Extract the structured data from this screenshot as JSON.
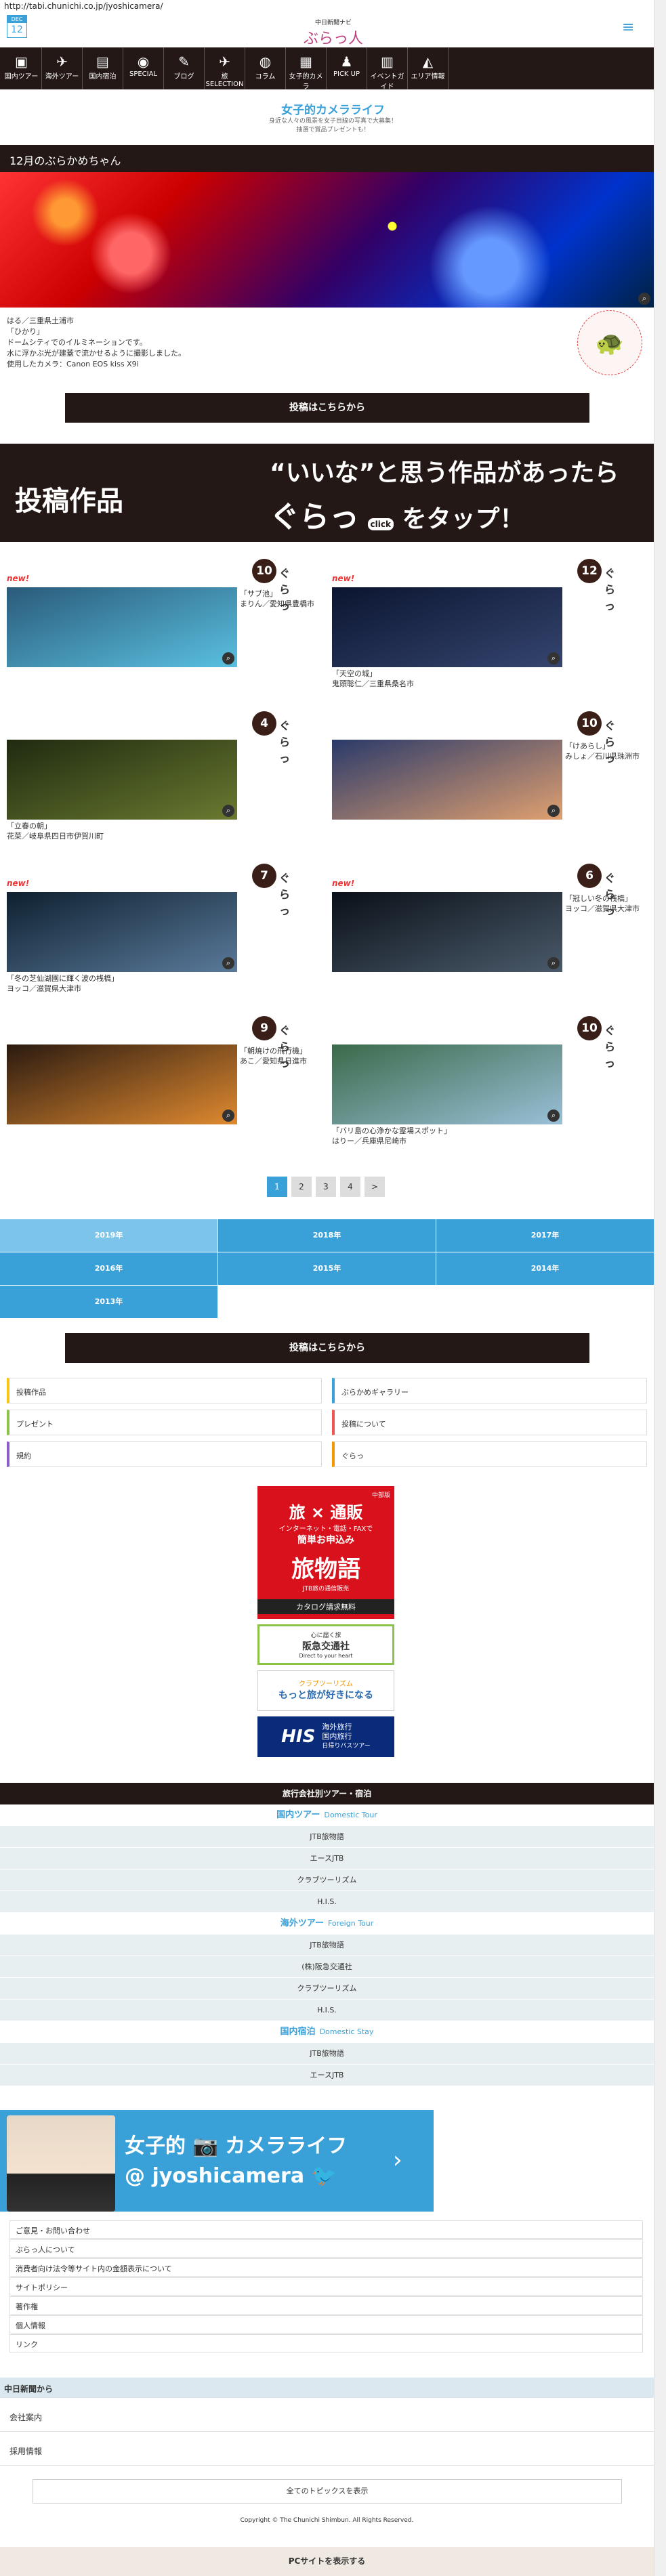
{
  "url": "http://tabi.chunichi.co.jp/jyoshicamera/",
  "date": {
    "month": "DEC",
    "day": "12"
  },
  "logo": {
    "small": "中日新聞ナビ",
    "big": "ぶらっ人"
  },
  "menu_icon": "hamburger-icon",
  "nav": [
    {
      "label": "国内ツアー",
      "icon": "▣"
    },
    {
      "label": "海外ツアー",
      "icon": "✈"
    },
    {
      "label": "国内宿泊",
      "icon": "▤"
    },
    {
      "label": "SPECIAL",
      "icon": "◉"
    },
    {
      "label": "ブログ",
      "icon": "✎"
    },
    {
      "label": "旅SELECTION",
      "icon": "✈"
    },
    {
      "label": "コラム",
      "icon": "◍"
    },
    {
      "label": "女子的カメラ",
      "icon": "▦"
    },
    {
      "label": "PICK UP",
      "icon": "♟"
    },
    {
      "label": "イベントガイド",
      "icon": "▥"
    },
    {
      "label": "エリア情報",
      "icon": "◭"
    }
  ],
  "tagline": {
    "title": "女子的カメラライフ",
    "sub1": "身近な人々の風景を女子目線の写真で大募集！",
    "sub2": "抽選で賞品プレゼントも！"
  },
  "month_title": "12月のぶらかめちゃん",
  "desc": [
    "はる／三重県土浦市",
    "「ひかり」",
    "ドームシティでのイルミネーションです。",
    "水に浮かぶ光が建蓋で流かせるように撮影しました。",
    "使用したカメラ：Canon EOS kiss X9i"
  ],
  "post_button": "投稿はこちらから",
  "banner": {
    "left": "投稿作品",
    "right1": "“いいな”と思う作品があったら",
    "right2_a": "ぐらっ",
    "right2_b": "をタップ！"
  },
  "new_label": "new!",
  "gura_label": "ぐらっ",
  "cards": [
    {
      "count": "10",
      "title": "「サブ池」",
      "author": "まりん／愛知県豊橋市",
      "colors": [
        "#2a5a7a",
        "#5ac0e0"
      ]
    },
    {
      "count": "12",
      "title": "「天空の城」",
      "author": "鬼頭聡仁／三重県桑名市",
      "colors": [
        "#0b1530",
        "#35456f"
      ]
    },
    {
      "count": "4",
      "title": "「立春の朝」",
      "author": "花菜／岐阜県四日市伊賀川町",
      "colors": [
        "#1f2a10",
        "#6a7a30"
      ]
    },
    {
      "count": "10",
      "title": "「けあらし」",
      "author": "みしょ／石川県珠洲市",
      "colors": [
        "#2a3a6a",
        "#e0a070"
      ]
    },
    {
      "count": "7",
      "title": "「冬の芝仙湖園に輝く波の桟橋」",
      "author": "ヨッコ／滋賀県大津市",
      "colors": [
        "#0e2030",
        "#5a7a9a"
      ]
    },
    {
      "count": "6",
      "title": "「冠しい冬の桟橋」",
      "author": "ヨッコ／滋賀県大津市",
      "colors": [
        "#0a1018",
        "#4a5a6a"
      ]
    },
    {
      "count": "9",
      "title": "「朝焼けの飛行機」",
      "author": "あこ／愛知県日進市",
      "colors": [
        "#2a1a10",
        "#e08a30"
      ]
    },
    {
      "count": "10",
      "title": "「バリ島の心浄かな霊場スポット」",
      "author": "はりー／兵庫県尼崎市",
      "colors": [
        "#3a6a4a",
        "#9ac0d8"
      ]
    }
  ],
  "pager": [
    "1",
    "2",
    "3",
    "4",
    ">"
  ],
  "years": [
    "2019年",
    "2018年",
    "2017年",
    "2016年",
    "2015年",
    "2014年",
    "2013年"
  ],
  "links": [
    {
      "label": "投稿作品",
      "color": "#f5c518"
    },
    {
      "label": "ぶらかめギャラリー",
      "color": "#3aa0d8"
    },
    {
      "label": "プレゼント",
      "color": "#8bc34a"
    },
    {
      "label": "投稿について",
      "color": "#e55"
    },
    {
      "label": "規約",
      "color": "#8a5cc8"
    },
    {
      "label": "ぐらっ",
      "color": "#f39800"
    }
  ],
  "ads": [
    {
      "name": "jtb-ad",
      "lines": [
        "中部版",
        "旅 × 通販",
        "インターネット・電話・FAXで",
        "簡単お申込み",
        "旅物語",
        "JTB旅の通信販売",
        "カタログ請求無料"
      ]
    },
    {
      "name": "hankyu-ad",
      "lines": [
        "心に届く旅",
        "阪急交通社",
        "Direct to your heart"
      ]
    },
    {
      "name": "club-tourism-ad",
      "lines": [
        "クラブツーリズム",
        "もっと旅が好きになる"
      ]
    },
    {
      "name": "his-ad",
      "lines": [
        "HIS",
        "海外旅行",
        "国内旅行",
        "日帰りバスツアー"
      ]
    }
  ],
  "tour_title": "旅行会社別ツアー・宿泊",
  "tours": [
    {
      "head": "国内ツアー",
      "en": "Domestic Tour",
      "rows": [
        "JTB旅物語",
        "エースJTB",
        "クラブツーリズム",
        "H.I.S."
      ]
    },
    {
      "head": "海外ツアー",
      "en": "Foreign Tour",
      "rows": [
        "JTB旅物語",
        "(株)阪急交通社",
        "クラブツーリズム",
        "H.I.S."
      ]
    },
    {
      "head": "国内宿泊",
      "en": "Domestic Stay",
      "rows": [
        "JTB旅物語",
        "エースJTB"
      ]
    }
  ],
  "ig": {
    "t": "女子的 📷 カメラライフ",
    "u": "@ jyoshicamera"
  },
  "footer_links": [
    "ご意見・お問い合わせ",
    "ぶらっ人について",
    "消費者向け法令等サイト内の金額表示について",
    "サイトポリシー",
    "著作権",
    "個人情報",
    "リンク"
  ],
  "chunichi": {
    "head": "中日新聞から",
    "rows": [
      "会社案内",
      "採用情報"
    ]
  },
  "all_topics": "全てのトピックスを表示",
  "copyright": "Copyright © The Chunichi Shimbun. All Rights Reserved.",
  "pc_site": "PCサイトを表示する"
}
